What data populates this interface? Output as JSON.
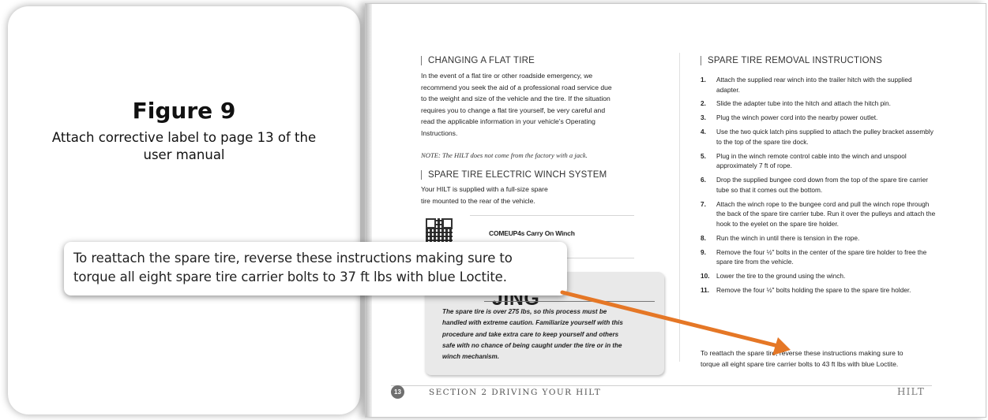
{
  "figure": {
    "title": "Figure 9",
    "description": "Attach corrective label to page 13 of the user manual"
  },
  "callout": {
    "line1": "To reattach the spare tire, reverse these instructions making sure to",
    "line2": "torque all eight spare tire carrier bolts to 37 ft lbs with blue Loctite."
  },
  "manual": {
    "flat_tire": {
      "heading": "CHANGING A FLAT TIRE",
      "lines": [
        "In the event of a flat tire or other roadside emergency, we",
        "recommend you seek the aid of a professional road service due",
        "to the weight and size of the vehicle and the tire. If the situation",
        "requires you to change a flat tire yourself, be very careful and",
        "read the applicable information in your vehicle's Operating",
        "Instructions."
      ],
      "note": "NOTE: The HILT does not come from the factory with a jack."
    },
    "winch": {
      "heading": "SPARE TIRE ELECTRIC WINCH SYSTEM",
      "lines": [
        "Your HILT is supplied with a full-size spare",
        "tire mounted to the rear of the vehicle."
      ],
      "qr_label": "COMEUP4s Carry On Winch"
    },
    "warning": {
      "title": "JING",
      "lines": [
        "The spare tire is over 275 lbs, so this process must be",
        "handled with extreme caution. Familiarize yourself with this",
        "procedure and take extra care to keep yourself and others",
        "safe with no chance of being caught under the tire or in the",
        "winch mechanism."
      ]
    },
    "removal": {
      "heading": "SPARE TIRE REMOVAL INSTRUCTIONS",
      "steps": [
        {
          "num": "1.",
          "text": "Attach the supplied rear winch into the trailer hitch with the supplied adapter."
        },
        {
          "num": "2.",
          "text": "Slide the adapter tube into the hitch and attach the hitch pin."
        },
        {
          "num": "3.",
          "text": "Plug the winch power cord into the nearby power outlet."
        },
        {
          "num": "4.",
          "text": "Use the two quick latch pins supplied to attach the pulley bracket assembly to the top of the spare tire dock."
        },
        {
          "num": "5.",
          "text": "Plug in the winch remote control cable into the winch and unspool approximately 7 ft of rope."
        },
        {
          "num": "6.",
          "text": "Drop the supplied bungee cord down from the top of the spare tire carrier tube so that it comes out the bottom."
        },
        {
          "num": "7.",
          "text": "Attach the winch rope to the bungee cord and pull the winch rope through the back of the spare tire carrier tube. Run it over the pulleys and attach the hook to the eyelet on the spare tire holder."
        },
        {
          "num": "8.",
          "text": "Run the winch in until there is tension in the rope."
        },
        {
          "num": "9.",
          "text": "Remove the four ½\" bolts in the center of the spare tire holder to free the spare tire from the vehicle."
        },
        {
          "num": "10.",
          "text": "Lower the tire to the ground using the winch."
        },
        {
          "num": "11.",
          "text": "Remove the four ½\" bolts holding the spare to the spare tire holder."
        }
      ],
      "reattach_line1": "To reattach the spare tire, reverse these instructions making sure to",
      "reattach_line2": "torque all eight spare tire carrier bolts to 43 ft lbs with blue Loctite."
    },
    "footer": {
      "page_number": "13",
      "section": "SECTION 2 DRIVING YOUR HILT",
      "brand": "HILT"
    }
  },
  "colors": {
    "arrow": "#e57726"
  }
}
